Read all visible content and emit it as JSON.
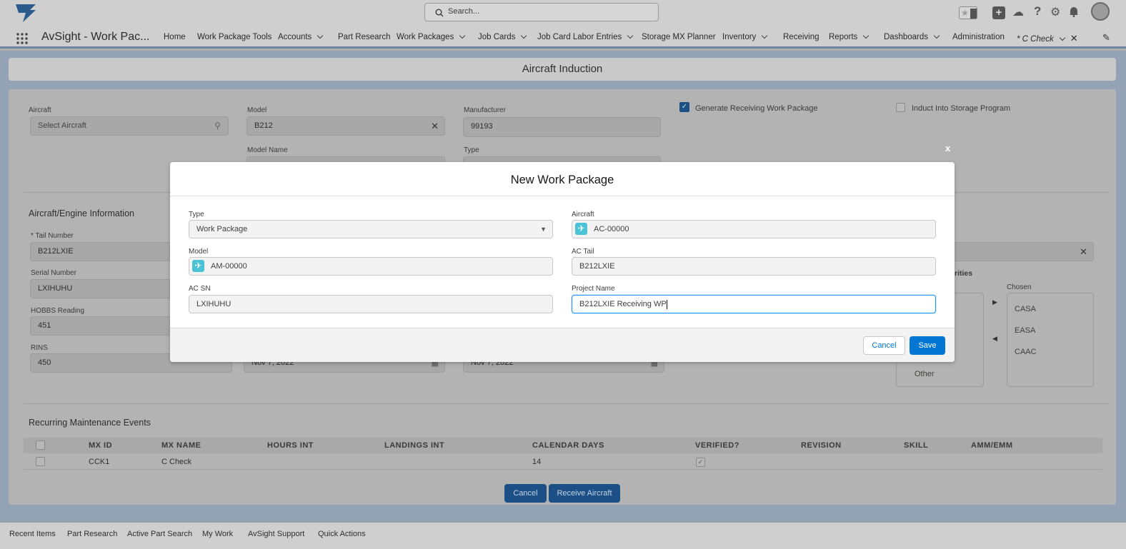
{
  "header": {
    "search_placeholder": "Search...",
    "app_name": "AvSight - Work Pac...",
    "nav": [
      {
        "label": "Home",
        "dropdown": false
      },
      {
        "label": "Work Package Tools",
        "dropdown": false
      },
      {
        "label": "Accounts",
        "dropdown": true
      },
      {
        "label": "Part Research",
        "dropdown": false
      },
      {
        "label": "Work Packages",
        "dropdown": true
      },
      {
        "label": "Job Cards",
        "dropdown": true
      },
      {
        "label": "Job Card Labor Entries",
        "dropdown": true
      },
      {
        "label": "Storage MX Planner",
        "dropdown": false
      },
      {
        "label": "Inventory",
        "dropdown": true
      },
      {
        "label": "Receiving",
        "dropdown": false
      },
      {
        "label": "Reports",
        "dropdown": true
      },
      {
        "label": "Dashboards",
        "dropdown": true
      },
      {
        "label": "Administration",
        "dropdown": false
      }
    ],
    "active_tab": "* C Check"
  },
  "page": {
    "title": "Aircraft Induction",
    "fields": {
      "aircraft_label": "Aircraft",
      "aircraft_placeholder": "Select Aircraft",
      "model_label": "Model",
      "model_value": "B212",
      "manufacturer_label": "Manufacturer",
      "manufacturer_value": "99193",
      "model_name_label": "Model Name",
      "type_label": "Type",
      "generate_receiving_label": "Generate Receiving Work Package",
      "generate_receiving_checked": true,
      "induct_storage_label": "Induct Into Storage Program",
      "induct_storage_checked": false
    },
    "engine_section": {
      "title": "Aircraft/Engine Information",
      "tail_label": "* Tail Number",
      "tail_value": "B212LXIE",
      "serial_label": "Serial Number",
      "serial_value": "LXIHUHU",
      "hobbs_label": "HOBBS Reading",
      "hobbs_value": "451",
      "rins_label": "RINS",
      "rins_value": "450",
      "date1": "Nov 7, 2022",
      "date2": "Nov 7, 2022"
    },
    "authorities": {
      "heading_partial": "rities",
      "available_partial": "Other",
      "chosen_label": "Chosen",
      "chosen": [
        "CASA",
        "EASA",
        "CAAC"
      ]
    },
    "recurring": {
      "title": "Recurring Maintenance Events",
      "columns": [
        "MX ID",
        "MX NAME",
        "HOURS INT",
        "LANDINGS INT",
        "CALENDAR DAYS",
        "VERIFIED?",
        "REVISION",
        "SKILL",
        "AMM/EMM"
      ],
      "rows": [
        {
          "mx_id": "CCK1",
          "mx_name": "C Check",
          "hours_int": "",
          "landings_int": "",
          "calendar_days": "14",
          "verified": true,
          "revision": "",
          "skill": "",
          "amm_emm": ""
        }
      ]
    },
    "cancel_label": "Cancel",
    "receive_label": "Receive Aircraft"
  },
  "modal": {
    "title": "New Work Package",
    "type_label": "Type",
    "type_value": "Work Package",
    "aircraft_label": "Aircraft",
    "aircraft_value": "AC-00000",
    "model_label": "Model",
    "model_value": "AM-00000",
    "ac_tail_label": "AC Tail",
    "ac_tail_value": "B212LXIE",
    "ac_sn_label": "AC SN",
    "ac_sn_value": "LXIHUHU",
    "project_name_label": "Project Name",
    "project_name_value": "B212LXIE Receiving WP",
    "cancel_label": "Cancel",
    "save_label": "Save",
    "close_label": "x"
  },
  "footer": {
    "items": [
      "Recent Items",
      "Part Research",
      "Active Part Search",
      "My Work",
      "AvSight Support",
      "Quick Actions"
    ]
  },
  "colors": {
    "brand_blue": "#0176d3",
    "focus_blue": "#1b96ff",
    "icon_teal": "#4bc3d6"
  }
}
